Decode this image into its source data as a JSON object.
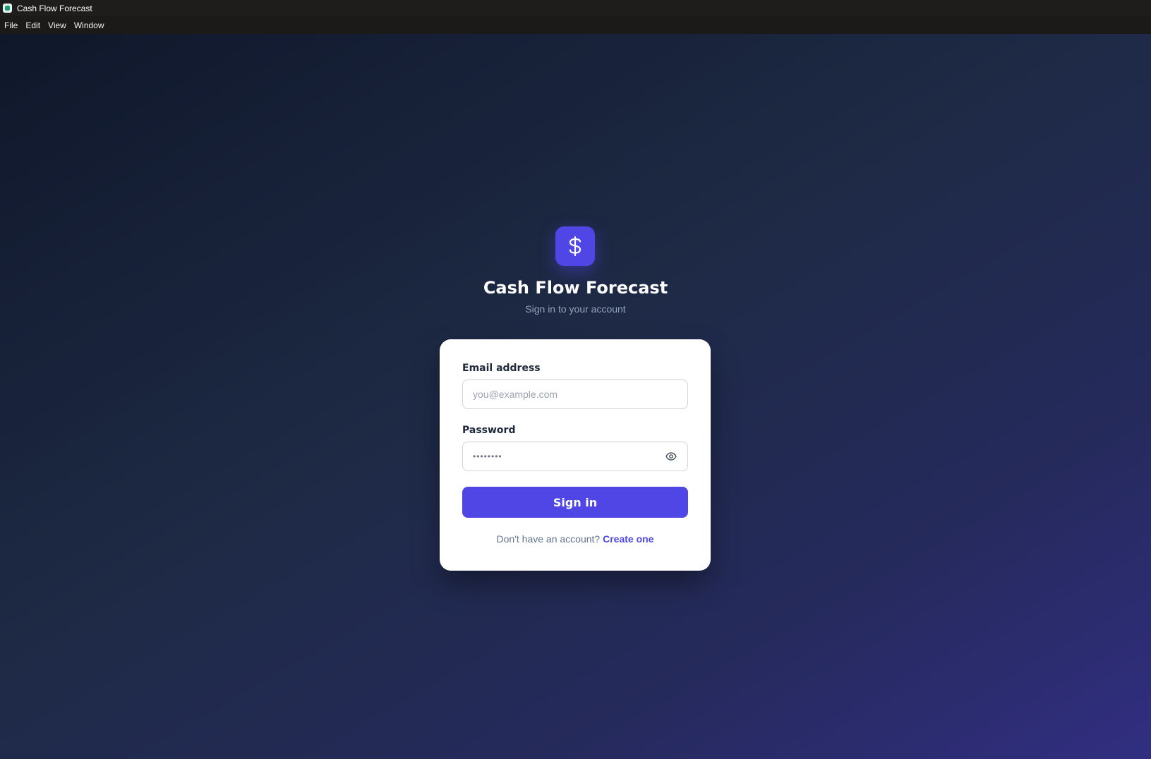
{
  "window": {
    "title": "Cash Flow Forecast",
    "app_icon": "app-icon"
  },
  "menu": [
    "File",
    "Edit",
    "View",
    "Window"
  ],
  "header": {
    "logo_icon": "dollar-icon",
    "title": "Cash Flow Forecast",
    "subtitle": "Sign in to your account"
  },
  "form": {
    "email_label": "Email address",
    "email_placeholder": "you@example.com",
    "email_value": "",
    "password_label": "Password",
    "password_masked": "••••••••",
    "password_toggle_icon": "eye-icon",
    "submit_label": "Sign in"
  },
  "footer": {
    "prompt": "Don't have an account?",
    "link_label": "Create one"
  },
  "colors": {
    "accent": "#4f46e5",
    "background_start": "#0f172a",
    "background_end": "#312e81"
  }
}
